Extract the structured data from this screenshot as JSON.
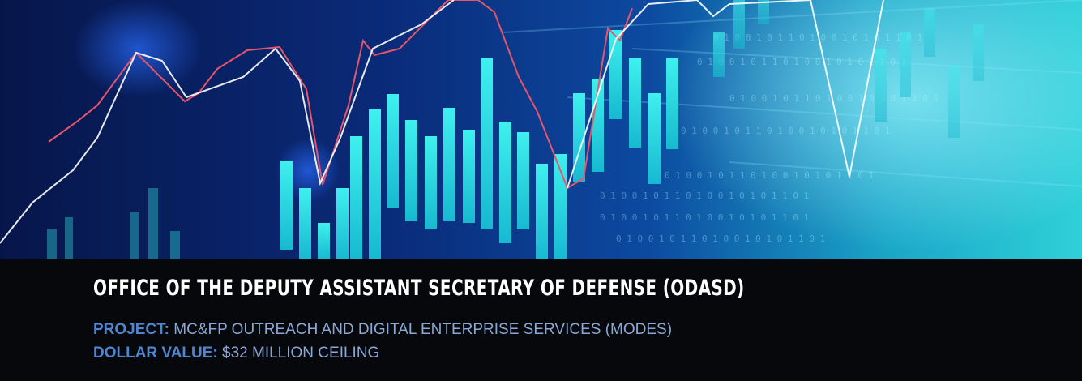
{
  "banner": {
    "title": "OFFICE OF THE DEPUTY ASSISTANT SECRETARY OF DEFENSE (ODASD)",
    "project_label": "PROJECT:",
    "project_value": "MC&FP OUTREACH AND DIGITAL ENTERPRISE SERVICES (MODES)",
    "dollar_label": "DOLLAR VALUE:",
    "dollar_value": "$32 MILLION CEILING"
  },
  "colors": {
    "accent_label": "#4f86cf",
    "value_text": "#8aa9d8",
    "title_text": "#ffffff",
    "bars": "#33e6e6",
    "trend_line": "#e8556a",
    "caption_bg": "#06080b"
  },
  "background": {
    "image": "financial-stock-chart-illustration",
    "binary_digits": "0 1 0 0 1 0 1 1 0 1 0 0 1 0 1 0 1 1 0 1"
  }
}
